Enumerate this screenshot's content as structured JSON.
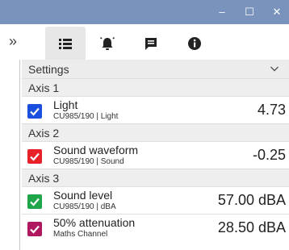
{
  "window": {
    "controls": {
      "minimize": "–",
      "maximize": "☐",
      "close": "✕"
    },
    "titlebar_color": "#7993bd"
  },
  "toolbar": {
    "collapse_glyph": "»",
    "tabs": [
      {
        "icon": "list-icon",
        "active": true
      },
      {
        "icon": "alarm-bell-icon",
        "active": false
      },
      {
        "icon": "notes-icon",
        "active": false
      },
      {
        "icon": "info-icon",
        "active": false
      }
    ]
  },
  "settings": {
    "label": "Settings",
    "expanded": true
  },
  "axes": [
    {
      "label": "Axis 1",
      "channels": [
        {
          "name": "Light",
          "source": "CU985/190 | Light",
          "value": "4.73",
          "color": "#1a4fe0",
          "checked": true
        }
      ]
    },
    {
      "label": "Axis 2",
      "channels": [
        {
          "name": "Sound waveform",
          "source": "CU985/190 | Sound",
          "value": "-0.25",
          "color": "#e8202a",
          "checked": true
        }
      ]
    },
    {
      "label": "Axis 3",
      "channels": [
        {
          "name": "Sound level",
          "source": "CU985/190 | dBA",
          "value": "57.00 dBA",
          "color": "#1fa64a",
          "checked": true
        },
        {
          "name": "50% attenuation",
          "source": "Maths Channel",
          "value": "28.50 dBA",
          "color": "#b0185f",
          "checked": true
        }
      ]
    }
  ]
}
